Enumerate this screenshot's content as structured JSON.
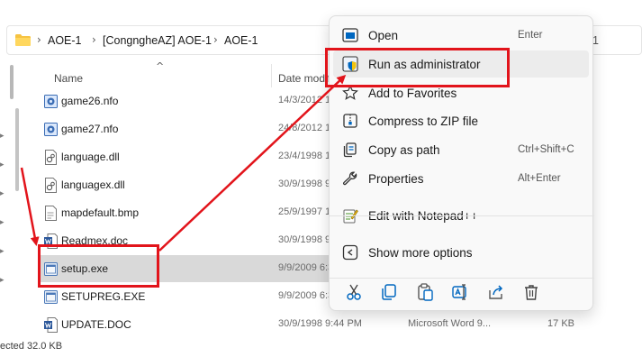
{
  "breadcrumb": {
    "segments": [
      "AOE-1",
      "[CongngheAZ] AOE-1",
      "AOE-1"
    ],
    "tail": "1"
  },
  "columns": {
    "name": "Name",
    "date": "Date modified"
  },
  "files": [
    {
      "name": "game26.nfo",
      "date": "14/3/2012 1",
      "type": "",
      "size": "",
      "icon": "nfo-file-icon"
    },
    {
      "name": "game27.nfo",
      "date": "24/8/2012 1",
      "type": "",
      "size": "",
      "icon": "nfo-file-icon"
    },
    {
      "name": "language.dll",
      "date": "23/4/1998 1",
      "type": "",
      "size": "",
      "icon": "dll-file-icon"
    },
    {
      "name": "languagex.dll",
      "date": "30/9/1998 9",
      "type": "",
      "size": "",
      "icon": "dll-file-icon"
    },
    {
      "name": "mapdefault.bmp",
      "date": "25/9/1997 1",
      "type": "",
      "size": "",
      "icon": "bmp-file-icon"
    },
    {
      "name": "Readmex.doc",
      "date": "30/9/1998 9",
      "type": "",
      "size": "",
      "icon": "word-doc-icon"
    },
    {
      "name": "setup.exe",
      "date": "9/9/2009 6:3",
      "type": "",
      "size": "",
      "icon": "exe-file-icon"
    },
    {
      "name": "SETUPREG.EXE",
      "date": "9/9/2009 6:3",
      "type": "",
      "size": "",
      "icon": "exe-file-icon"
    },
    {
      "name": "UPDATE.DOC",
      "date": "30/9/1998 9:44 PM",
      "type": "Microsoft Word 9...",
      "size": "17 KB",
      "icon": "word-doc-icon"
    }
  ],
  "status_bar": {
    "text": "ected  32.0 KB"
  },
  "context_menu": {
    "items": [
      {
        "label": "Open",
        "shortcut": "Enter",
        "icon": "open-app-icon"
      },
      {
        "label": "Run as administrator",
        "shortcut": "",
        "icon": "shield-icon"
      },
      {
        "label": "Add to Favorites",
        "shortcut": "",
        "icon": "star-icon"
      },
      {
        "label": "Compress to ZIP file",
        "shortcut": "",
        "icon": "zip-icon"
      },
      {
        "label": "Copy as path",
        "shortcut": "Ctrl+Shift+C",
        "icon": "copy-path-icon"
      },
      {
        "label": "Properties",
        "shortcut": "Alt+Enter",
        "icon": "wrench-icon"
      },
      {
        "label": "Edit with Notepad++",
        "shortcut": "",
        "icon": "notepad-plus-plus-icon"
      },
      {
        "label": "Show more options",
        "shortcut": "",
        "icon": "more-options-icon"
      }
    ],
    "actions": [
      "cut-icon",
      "copy-icon",
      "paste-icon",
      "rename-icon",
      "share-icon",
      "delete-icon"
    ]
  },
  "colors": {
    "annotation_red": "#e2141b",
    "selected_row": "#d9d9d9",
    "menu_bg": "#f9f9f9",
    "accent_blue": "#0067c0"
  }
}
